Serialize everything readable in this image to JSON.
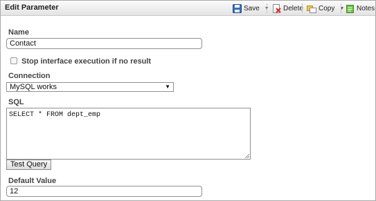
{
  "header": {
    "title": "Edit Parameter",
    "save_label": "Save",
    "delete_label": "Delete",
    "copy_label": "Copy",
    "notes_label": "Notes"
  },
  "form": {
    "name_label": "Name",
    "name_value": "Contact",
    "stop_label": "Stop interface execution if no result",
    "stop_checked": false,
    "connection_label": "Connection",
    "connection_value": "MySQL works",
    "sql_label": "SQL",
    "sql_value": "SELECT * FROM dept_emp",
    "test_query_label": "Test Query",
    "default_label": "Default Value",
    "default_value": "12"
  }
}
